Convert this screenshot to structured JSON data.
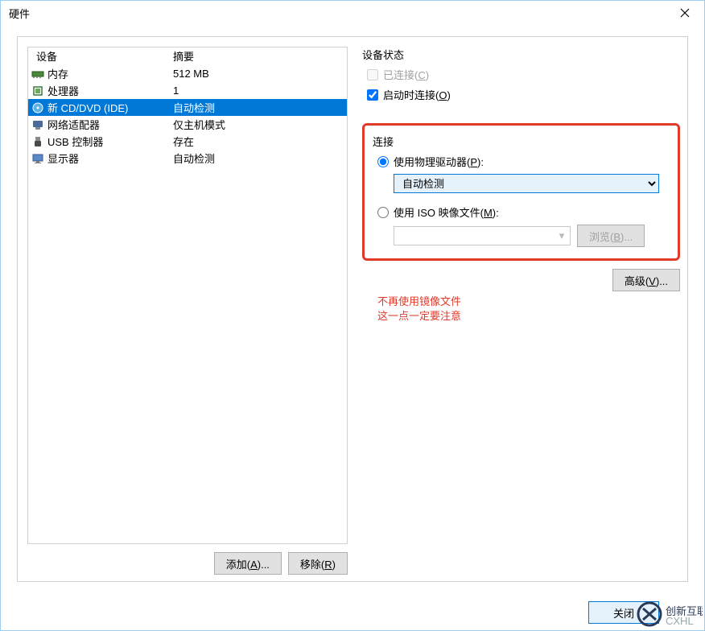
{
  "window": {
    "title": "硬件"
  },
  "deviceList": {
    "headers": {
      "device": "设备",
      "summary": "摘要"
    },
    "items": [
      {
        "name": "内存",
        "summary": "512 MB",
        "icon": "memory"
      },
      {
        "name": "处理器",
        "summary": "1",
        "icon": "cpu"
      },
      {
        "name": "新 CD/DVD (IDE)",
        "summary": "自动检测",
        "icon": "cd",
        "selected": true
      },
      {
        "name": "网络适配器",
        "summary": "仅主机模式",
        "icon": "nic"
      },
      {
        "name": "USB 控制器",
        "summary": "存在",
        "icon": "usb"
      },
      {
        "name": "显示器",
        "summary": "自动检测",
        "icon": "display"
      }
    ]
  },
  "buttons": {
    "add": "添加(A)...",
    "remove": "移除(R)",
    "add_acc": "A",
    "remove_acc": "R"
  },
  "status": {
    "legend": "设备状态",
    "connected_label": "已连接(C)",
    "connected_acc": "C",
    "connected_checked": false,
    "connected_disabled": true,
    "poweron_label": "启动时连接(O)",
    "poweron_acc": "O",
    "poweron_checked": true
  },
  "connection": {
    "legend": "连接",
    "physical_label": "使用物理驱动器(P):",
    "physical_acc": "P",
    "physical_selected": true,
    "physical_dropdown": "自动检测",
    "iso_label": "使用 ISO 映像文件(M):",
    "iso_acc": "M",
    "iso_selected": false,
    "iso_value": "",
    "browse_label": "浏览(B)...",
    "browse_acc": "B"
  },
  "advanced": {
    "label": "高级(V)...",
    "acc": "V"
  },
  "annotation": {
    "line1": "不再使用镜像文件",
    "line2": "这一点一定要注意"
  },
  "footer": {
    "close": "关闭"
  },
  "logo": {
    "text": "创新互联"
  }
}
